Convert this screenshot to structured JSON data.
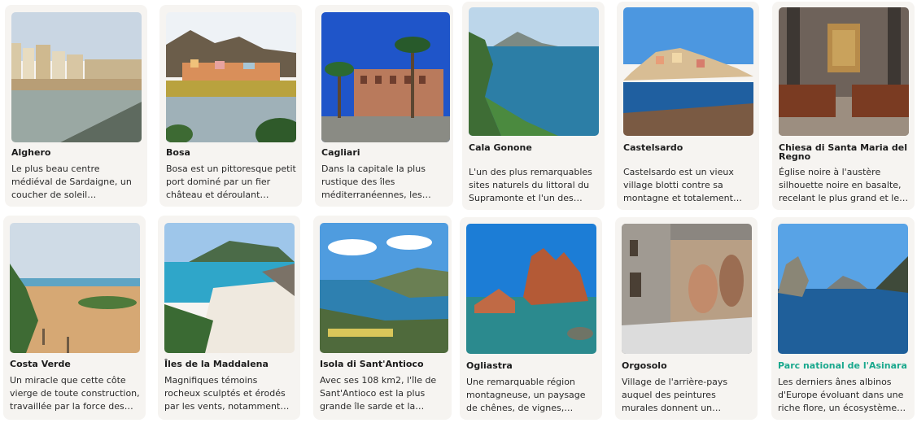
{
  "accent_color": "#1aa88d",
  "cards": [
    {
      "title": "Alghero",
      "description": "Le plus beau centre médiéval de Sardaigne, un coucher de soleil d'anthologie sur les…",
      "image": "coastal-town-walls-image"
    },
    {
      "title": "Bosa",
      "description": "Bosa est un pittoresque petit port dominé par un fier château et déroulant…",
      "image": "colorful-hillside-town-image"
    },
    {
      "title": "Cagliari",
      "description": "Dans la capitale la plus rustique des îles méditerranéennes, les…",
      "image": "palm-square-palace-image"
    },
    {
      "title": "Cala Gonone",
      "description": "L'un des plus remarquables sites naturels du littoral du Supramonte et l'un des mieux…",
      "image": "cliff-coastline-image"
    },
    {
      "title": "Castelsardo",
      "description": "Castelsardo est un vieux village blotti contre sa montagne et totalement…",
      "image": "hilltop-village-sea-image"
    },
    {
      "title": "Chiesa di Santa Maria del Regno",
      "description": "Église noire à l'austère silhouette noire en basalte, recelant le plus grand et le…",
      "image": "church-interior-image"
    },
    {
      "title": "Costa Verde",
      "description": "Un miracle que cette côte vierge de toute construction, travaillée par la force des…",
      "image": "sand-dunes-beach-image"
    },
    {
      "title": "Îles de la Maddalena",
      "description": "Magnifiques témoins rocheux sculptés et érodés par les vents, notamment isola…",
      "image": "turquoise-cove-image"
    },
    {
      "title": "Isola di Sant'Antioco",
      "description": "Avec ses 108 km2, l'île de Sant'Antioco est la plus grande île sarde et la…",
      "image": "island-headland-image"
    },
    {
      "title": "Ogliastra",
      "description": "Une remarquable région montagneuse, un paysage de chênes, de vignes, d'oliveraie…",
      "image": "red-rock-sea-image"
    },
    {
      "title": "Orgosolo",
      "description": "Village de l'arrière-pays auquel des peintures murales donnent un caractère unique…",
      "image": "mural-street-image"
    },
    {
      "title": "Parc national de l'Asinara",
      "description": "Les derniers ânes albinos d'Europe évoluant dans une riche flore, un écosystème…",
      "image": "rocky-sea-islets-image"
    }
  ]
}
